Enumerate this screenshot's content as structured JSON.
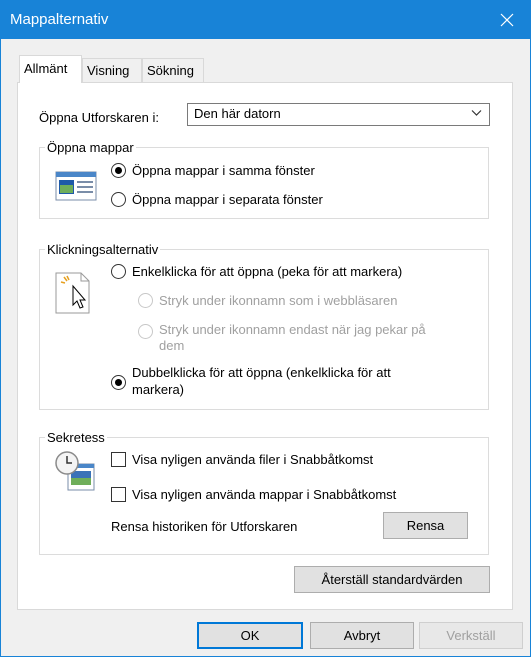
{
  "window": {
    "title": "Mappalternativ",
    "close_icon": "close-icon"
  },
  "tabs": [
    {
      "label": "Allmänt",
      "active": true
    },
    {
      "label": "Visning",
      "active": false
    },
    {
      "label": "Sökning",
      "active": false
    }
  ],
  "explorer": {
    "label": "Öppna Utforskaren i:",
    "selected": "Den här datorn"
  },
  "browse_folders": {
    "title": "Öppna mappar",
    "icon": "folder-window-icon",
    "options": [
      {
        "label": "Öppna mappar i samma fönster",
        "checked": true
      },
      {
        "label": "Öppna mappar i separata fönster",
        "checked": false
      }
    ]
  },
  "click_options": {
    "title": "Klickningsalternativ",
    "icon": "pointer-click-icon",
    "single_click": "Enkelklicka för att öppna (peka för att markera)",
    "underline_browser": "Stryk under ikonnamn som i webbläsaren",
    "underline_hover_line1": "Stryk under ikonnamn endast när jag pekar på",
    "underline_hover_line2": "dem",
    "double_click_line1": "Dubbelklicka för att öppna (enkelklicka för att",
    "double_click_line2": "markera)"
  },
  "privacy": {
    "title": "Sekretess",
    "icon": "recent-files-clock-icon",
    "recent_files": "Visa nyligen använda filer i Snabbåtkomst",
    "recent_folders": "Visa nyligen använda mappar i Snabbåtkomst",
    "clear_label": "Rensa historiken för Utforskaren",
    "clear_button": "Rensa"
  },
  "restore_button": "Återställ standardvärden",
  "footer": {
    "ok": "OK",
    "cancel": "Avbryt",
    "apply": "Verkställ"
  },
  "colors": {
    "titlebar": "#1883d7",
    "default_button_border": "#0078d7"
  }
}
